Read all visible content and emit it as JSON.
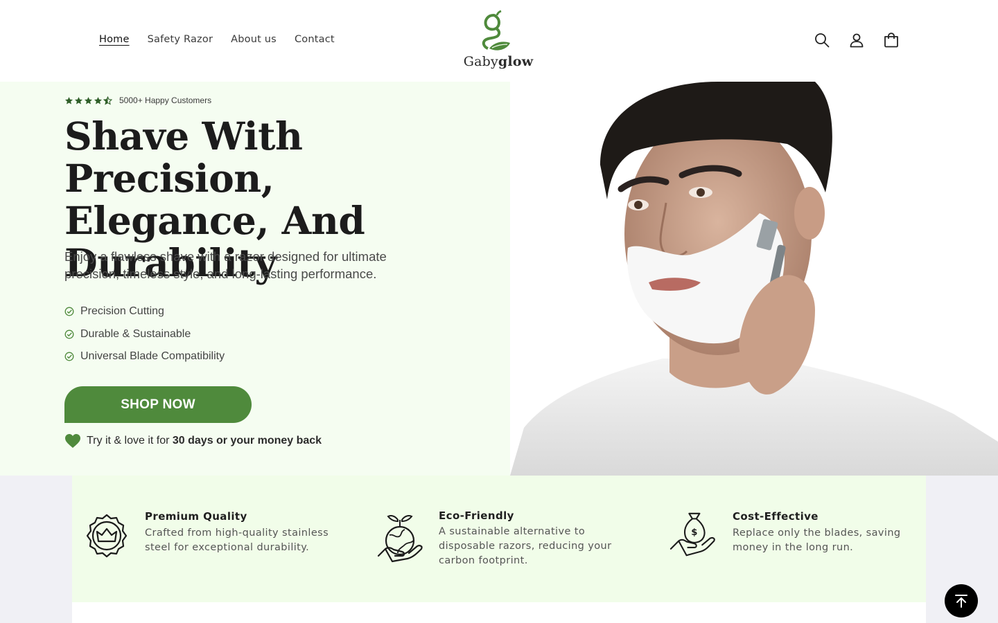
{
  "header": {
    "nav": [
      {
        "label": "Home",
        "active": true
      },
      {
        "label": "Safety Razor",
        "active": false
      },
      {
        "label": "About us",
        "active": false
      },
      {
        "label": "Contact",
        "active": false
      }
    ],
    "logo": {
      "text_regular": "Gaby",
      "text_bold": "glow"
    },
    "icons": [
      "search-icon",
      "account-icon",
      "cart-icon"
    ]
  },
  "hero": {
    "rating": {
      "stars": 4.5,
      "text": "5000+ Happy Customers"
    },
    "title": "Shave With Precision, Elegance, And Durability",
    "subtitle": "Enjoy a flawless shave with a razor designed for ultimate precision, timeless style, and long-lasting performance.",
    "features": [
      "Precision Cutting",
      "Durable & Sustainable",
      "Universal Blade Compatibility"
    ],
    "cta_label": "SHOP NOW",
    "guarantee_prefix": "Try it & love it for ",
    "guarantee_bold": "30 days or your money back"
  },
  "benefits": [
    {
      "icon": "crown-badge-icon",
      "title": "Premium Quality",
      "desc": "Crafted from high-quality stainless steel for exceptional durability."
    },
    {
      "icon": "globe-hand-icon",
      "title": "Eco-Friendly",
      "desc": "A sustainable alternative to disposable razors, reducing your carbon footprint."
    },
    {
      "icon": "money-hand-icon",
      "title": "Cost-Effective",
      "desc": "Replace only the blades, saving money in the long run."
    }
  ],
  "colors": {
    "accent": "#4f8a3c",
    "hero_bg": "#f5fdf1",
    "benefits_bg": "#f1fde9"
  }
}
